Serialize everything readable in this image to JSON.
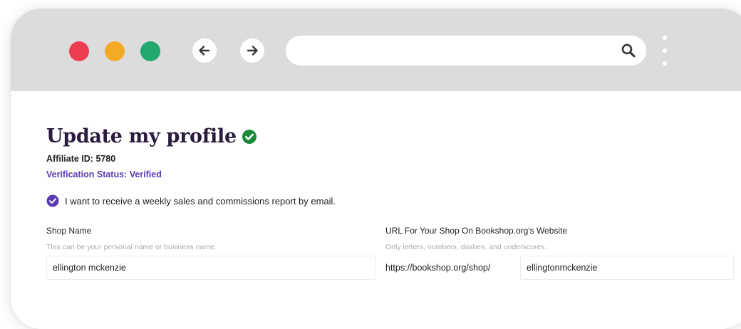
{
  "browser": {
    "address_value": "",
    "colors": {
      "close": "#ee3d53",
      "minimize": "#f3ab26",
      "maximize": "#23a86f",
      "chrome": "#dcdcdc"
    },
    "icons": {
      "back": "arrow-left-icon",
      "forward": "arrow-right-icon",
      "search": "search-icon",
      "menu": "kebab-menu-icon"
    }
  },
  "page": {
    "title": "Update my profile",
    "affiliate_id": "Affiliate ID: 5780",
    "verification_status": "Verification Status: Verified",
    "weekly_report": {
      "label": "I want to receive a weekly sales and commissions report by email.",
      "checked": true
    },
    "shop_name": {
      "label": "Shop Name",
      "hint": "This can be your personal name or business name.",
      "value": "ellington mckenzie"
    },
    "shop_url": {
      "label": "URL For Your Shop On Bookshop.org's Website",
      "hint": "Only letters, numbers, dashes, and underscores.",
      "prefix": "https://bookshop.org/shop/",
      "value": "ellingtonmckenzie"
    },
    "colors": {
      "title": "#2a1c3e",
      "accent": "#5a3bb0",
      "verified": "#1a8a3a"
    }
  }
}
